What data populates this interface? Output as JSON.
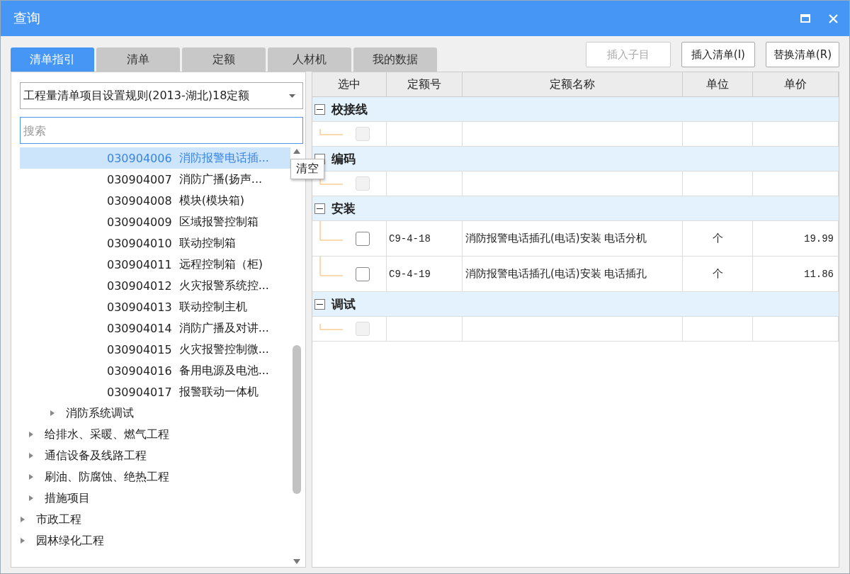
{
  "window": {
    "title": "查询"
  },
  "tabs": [
    {
      "label": "清单指引",
      "selected": true
    },
    {
      "label": "清单",
      "selected": false
    },
    {
      "label": "定额",
      "selected": false
    },
    {
      "label": "人材机",
      "selected": false
    },
    {
      "label": "我的数据",
      "selected": false
    }
  ],
  "buttons": [
    {
      "label": "插入子目",
      "disabled": true
    },
    {
      "label": "插入清单(I)",
      "disabled": false
    },
    {
      "label": "替换清单(R)",
      "disabled": false
    }
  ],
  "library_select": {
    "value": "工程量清单项目设置规则(2013-湖北)18定额"
  },
  "search": {
    "placeholder": "搜索"
  },
  "tree": {
    "items": [
      {
        "children": [
          {
            "children": [
              {
                "children": [
                  {
                    "kind": "leaf",
                    "code": "030904006",
                    "label": "消防报警电话插...",
                    "selected": true
                  },
                  {
                    "kind": "leaf",
                    "code": "030904007",
                    "label": "消防广播(扬声...",
                    "selected": false
                  },
                  {
                    "kind": "leaf",
                    "code": "030904008",
                    "label": "模块(模块箱)",
                    "selected": false
                  },
                  {
                    "kind": "leaf",
                    "code": "030904009",
                    "label": "区域报警控制箱",
                    "selected": false
                  },
                  {
                    "kind": "leaf",
                    "code": "030904010",
                    "label": "联动控制箱",
                    "selected": false
                  },
                  {
                    "kind": "leaf",
                    "code": "030904011",
                    "label": "远程控制箱（柜)",
                    "selected": false
                  },
                  {
                    "kind": "leaf",
                    "code": "030904012",
                    "label": "火灾报警系统控...",
                    "selected": false
                  },
                  {
                    "kind": "leaf",
                    "code": "030904013",
                    "label": "联动控制主机",
                    "selected": false
                  },
                  {
                    "kind": "leaf",
                    "code": "030904014",
                    "label": "消防广播及对讲...",
                    "selected": false
                  },
                  {
                    "kind": "leaf",
                    "code": "030904015",
                    "label": "火灾报警控制微...",
                    "selected": false
                  },
                  {
                    "kind": "leaf",
                    "code": "030904016",
                    "label": "备用电源及电池...",
                    "selected": false
                  },
                  {
                    "kind": "leaf",
                    "code": "030904017",
                    "label": "报警联动一体机",
                    "selected": false
                  }
                ]
              },
              {
                "kind": "folder",
                "label": "消防系统调试",
                "expanded": false,
                "selected": false
              }
            ]
          },
          {
            "kind": "folder",
            "label": "给排水、采暖、燃气工程",
            "expanded": false,
            "selected": false
          },
          {
            "kind": "folder",
            "label": "通信设备及线路工程",
            "expanded": false,
            "selected": false
          },
          {
            "kind": "folder",
            "label": "刷油、防腐蚀、绝热工程",
            "expanded": false,
            "selected": false
          },
          {
            "kind": "folder",
            "label": "措施项目",
            "expanded": false,
            "selected": false
          }
        ]
      },
      {
        "kind": "folder",
        "label": "市政工程",
        "expanded": false,
        "selected": false
      },
      {
        "kind": "folder",
        "label": "园林绿化工程",
        "expanded": false,
        "selected": false
      }
    ]
  },
  "tooltip": "清空",
  "table": {
    "columns": [
      "选中",
      "定额号",
      "定额名称",
      "单位",
      "单价"
    ],
    "groups": [
      {
        "title": "校接线",
        "expanded": true,
        "rows": [
          {
            "checked": false,
            "disabled": true
          }
        ]
      },
      {
        "title": "编码",
        "expanded": true,
        "rows": [
          {
            "checked": false,
            "disabled": true
          }
        ]
      },
      {
        "title": "安装",
        "expanded": true,
        "rows": [
          {
            "checked": false,
            "disabled": false,
            "code": "C9-4-18",
            "name": "消防报警电话插孔(电话)安装 电话分机",
            "unit": "个",
            "price": "19.99"
          },
          {
            "checked": false,
            "disabled": false,
            "code": "C9-4-19",
            "name": "消防报警电话插孔(电话)安装 电话插孔",
            "unit": "个",
            "price": "11.86"
          }
        ]
      },
      {
        "title": "调试",
        "expanded": true,
        "rows": [
          {
            "checked": false,
            "disabled": true
          }
        ]
      }
    ]
  }
}
